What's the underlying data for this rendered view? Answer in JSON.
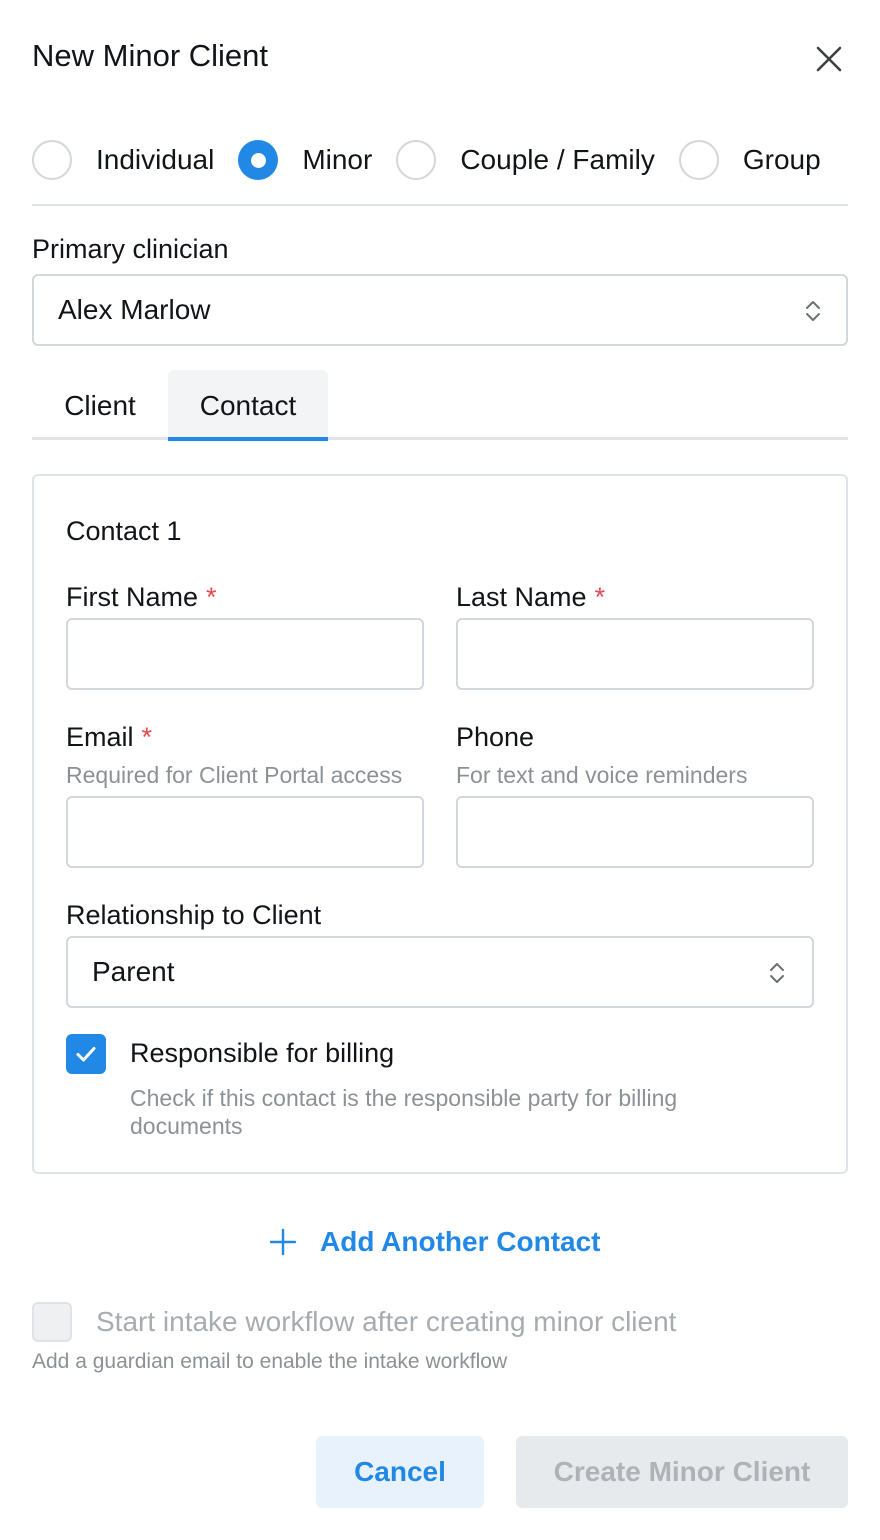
{
  "dialog": {
    "title": "New Minor Client"
  },
  "client_types": [
    {
      "label": "Individual",
      "selected": false
    },
    {
      "label": "Minor",
      "selected": true
    },
    {
      "label": "Couple / Family",
      "selected": false
    },
    {
      "label": "Group",
      "selected": false
    }
  ],
  "primary_clinician": {
    "label": "Primary clinician",
    "value": "Alex Marlow"
  },
  "tabs": [
    {
      "label": "Client",
      "active": false
    },
    {
      "label": "Contact",
      "active": true
    }
  ],
  "contact": {
    "heading": "Contact 1",
    "first_name": {
      "label": "First Name",
      "required_mark": "*",
      "value": ""
    },
    "last_name": {
      "label": "Last Name",
      "required_mark": "*",
      "value": ""
    },
    "email": {
      "label": "Email",
      "required_mark": "*",
      "hint": "Required for Client Portal access",
      "value": ""
    },
    "phone": {
      "label": "Phone",
      "hint": "For text and voice reminders",
      "value": ""
    },
    "relationship": {
      "label": "Relationship to Client",
      "value": "Parent"
    },
    "billing": {
      "label": "Responsible for billing",
      "checked": true,
      "hint": "Check if this contact is the responsible party for billing documents"
    }
  },
  "add_contact": {
    "label": "Add Another Contact"
  },
  "intake": {
    "label": "Start intake workflow after creating minor client",
    "checked": false,
    "disabled": true,
    "hint": "Add a guardian email to enable the intake workflow"
  },
  "footer": {
    "cancel_label": "Cancel",
    "create_label": "Create Minor Client"
  },
  "colors": {
    "accent": "#2189e5",
    "required": "#e5484d",
    "muted_text": "#8c9196",
    "disabled_bg": "#e7eaed"
  },
  "icons": {
    "close": "close-icon",
    "select_arrows": "chevron-up-down-icon",
    "checkmark": "check-icon",
    "add": "plus-icon"
  }
}
